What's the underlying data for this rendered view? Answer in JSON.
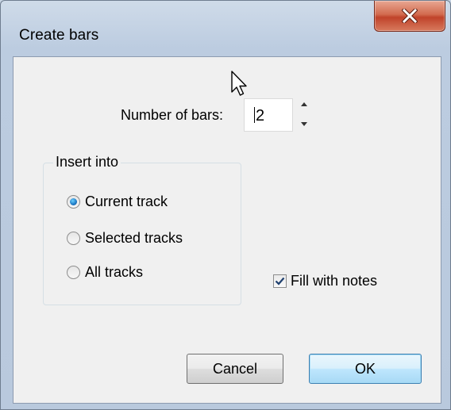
{
  "window": {
    "title": "Create bars",
    "close_icon": "close-icon",
    "colors": {
      "frame": "#bccce0",
      "close_button": "#c0432a",
      "client_bg": "#f0f0f0",
      "accent": "#1c77c3"
    }
  },
  "bars": {
    "label": "Number of bars:",
    "value": "2",
    "up_icon": "spin-up-icon",
    "down_icon": "spin-down-icon"
  },
  "insert_into": {
    "label": "Insert into",
    "options": [
      {
        "label": "Current track",
        "checked": true
      },
      {
        "label": "Selected tracks",
        "checked": false
      },
      {
        "label": "All tracks",
        "checked": false
      }
    ]
  },
  "fill_notes": {
    "label": "Fill with notes",
    "checked": true
  },
  "buttons": {
    "cancel": "Cancel",
    "ok": "OK"
  }
}
